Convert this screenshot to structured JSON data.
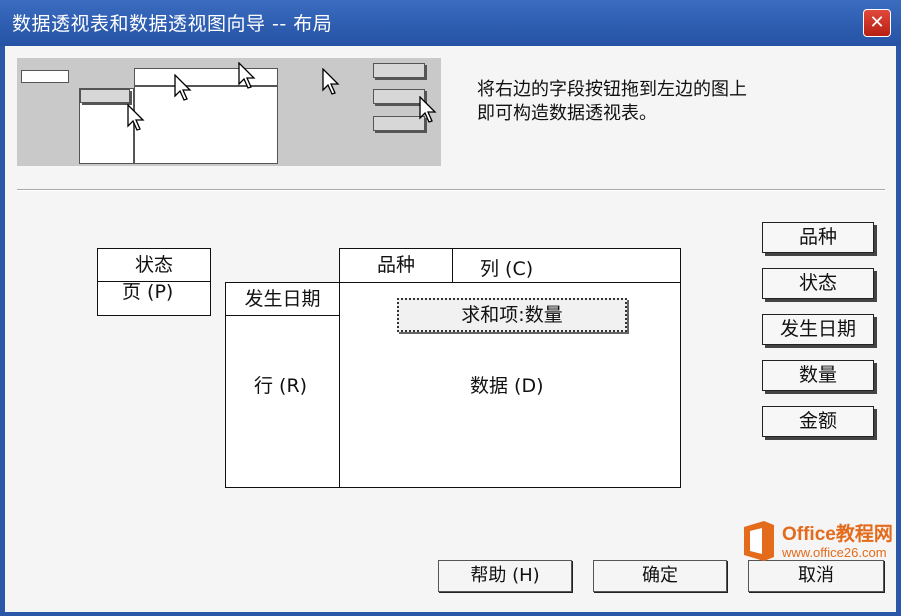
{
  "window": {
    "title": "数据透视表和数据透视图向导 -- 布局",
    "close_label": "✕"
  },
  "instruction": {
    "line1": "将右边的字段按钮拖到左边的图上",
    "line2": "即可构造数据透视表。"
  },
  "layout": {
    "page_field": "状态",
    "page_area_label": "页 (P)",
    "row_field": "发生日期",
    "row_area_label": "行 (R)",
    "column_field": "品种",
    "column_area_label": "列 (C)",
    "data_field": "求和项:数量",
    "data_area_label": "数据 (D)"
  },
  "fields": [
    {
      "label": "品种"
    },
    {
      "label": "状态"
    },
    {
      "label": "发生日期"
    },
    {
      "label": "数量"
    },
    {
      "label": "金额"
    }
  ],
  "buttons": {
    "help": "帮助 (H)",
    "ok": "确定",
    "cancel": "取消"
  },
  "watermark": {
    "text": "Office教程网",
    "url": "www.office26.com"
  },
  "colors": {
    "titlebar": "#2a57a8",
    "close": "#c8281c",
    "watermark": "#e46b1c"
  }
}
